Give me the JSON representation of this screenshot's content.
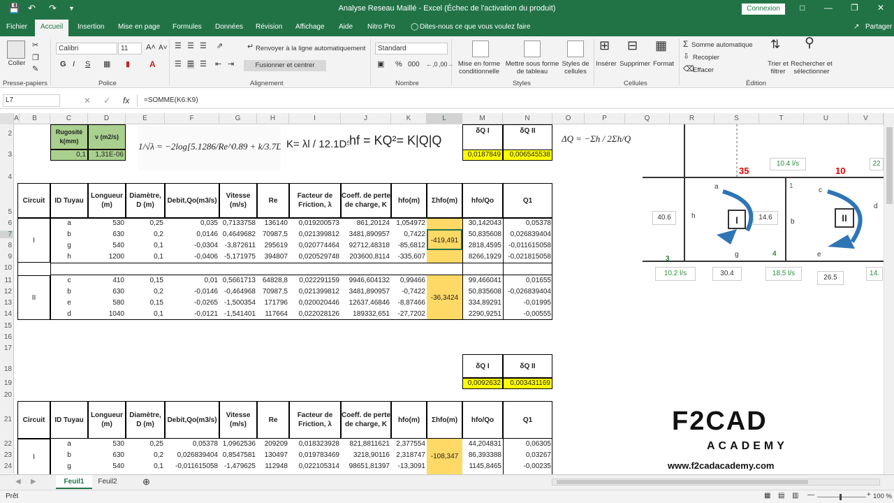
{
  "app": {
    "title": "Analyse Reseau Maillé - Excel (Échec de l'activation du produit)",
    "login": "Connexion",
    "share": "Partager",
    "tell_me": "Dites-nous ce que vous voulez faire"
  },
  "tabs": [
    "Fichier",
    "Accueil",
    "Insertion",
    "Mise en page",
    "Formules",
    "Données",
    "Révision",
    "Affichage",
    "Aide",
    "Nitro Pro"
  ],
  "ribbon": {
    "paste": "Coller",
    "font_name": "Calibri",
    "font_size": "11",
    "wrap": "Renvoyer à la ligne automatiquement",
    "merge": "Fusionner et centrer",
    "number_format": "Standard",
    "cond_format": "Mise en forme conditionnelle",
    "table_format": "Mettre sous forme de tableau",
    "cell_styles": "Styles de cellules",
    "insert": "Insérer",
    "delete": "Supprimer",
    "format": "Format",
    "autosum": "Somme automatique",
    "fill": "Recopier",
    "clear": "Effacer",
    "sort": "Trier et filtrer",
    "find": "Rechercher et sélectionner",
    "groups": [
      "Presse-papiers",
      "Police",
      "Alignement",
      "Nombre",
      "Styles",
      "Cellules",
      "Édition"
    ]
  },
  "formula_bar": {
    "name_box": "L7",
    "formula": "=SOMME(K6:K9)"
  },
  "columns": [
    "A",
    "B",
    "C",
    "D",
    "E",
    "F",
    "G",
    "H",
    "I",
    "J",
    "K",
    "L",
    "M",
    "N",
    "O",
    "P",
    "Q",
    "R",
    "S",
    "T",
    "U",
    "V"
  ],
  "rows": [
    "2",
    "3",
    "4",
    "5",
    "6",
    "7",
    "8",
    "9",
    "10",
    "11",
    "12",
    "13",
    "14",
    "15",
    "16",
    "17",
    "18",
    "19",
    "20",
    "21",
    "22",
    "23",
    "24"
  ],
  "top": {
    "rugosite": "Rugosité k(mm)",
    "nu": "ν (m2/s)",
    "k": "0,1",
    "nu_val": "1,31E-06",
    "dq1": "δQ I",
    "dq2": "δQ II",
    "dq1_val": "0,0187849",
    "dq2_val": "0,006545538",
    "eq_colebrook": "1/√λ = −2log[5.1286/Re^0.89 + k/3.7D]",
    "eq_k": "K= λl / 12.1D⁵",
    "eq_hf": "hf = KQ²= K|Q|Q",
    "eq_dq": "ΔQ = −Σh / 2Σh/Q"
  },
  "headers": [
    "Circuit",
    "ID Tuyau",
    "Longueur (m)",
    "Diamètre, D (m)",
    "Debit,Qo(m3/s)",
    "Vitesse (m/s)",
    "Re",
    "Facteur de Friction, λ",
    "Coeff. de perte de charge, K",
    "hfo(m)",
    "Σhfo(m)",
    "hfo/Qo",
    "Q1"
  ],
  "table1": {
    "circuit1": "I",
    "circuit2": "II",
    "sum1": "-419,491",
    "sum2": "-36,3424",
    "rows1": [
      [
        "a",
        "530",
        "0,25",
        "0,035",
        "0,7133758",
        "136140",
        "0,019200573",
        "861,20124",
        "1,054972",
        "30,142043",
        "0,05378"
      ],
      [
        "b",
        "630",
        "0,2",
        "0,0146",
        "0,4649682",
        "70987,5",
        "0,021399812",
        "3481,890957",
        "0,7422",
        "50,835608",
        "0,026839404"
      ],
      [
        "g",
        "540",
        "0,1",
        "-0,0304",
        "-3,872611",
        "295619",
        "0,020774464",
        "92712,48318",
        "-85,6812",
        "2818,4595",
        "-0,011615058"
      ],
      [
        "h",
        "1200",
        "0,1",
        "-0,0406",
        "-5,171975",
        "394807",
        "0,020529748",
        "203600,8114",
        "-335,607",
        "8266,1929",
        "-0,021815058"
      ]
    ],
    "rows2": [
      [
        "c",
        "410",
        "0,15",
        "0,01",
        "0,5661713",
        "64828,8",
        "0,022291159",
        "9946,604132",
        "0,99466",
        "99,466041",
        "0,01655"
      ],
      [
        "b",
        "630",
        "0,2",
        "-0,0146",
        "-0,464968",
        "70987,5",
        "0,021399812",
        "3481,890957",
        "-0,7422",
        "50,835608",
        "-0,026839404"
      ],
      [
        "e",
        "580",
        "0,15",
        "-0,0265",
        "-1,500354",
        "171796",
        "0,020020446",
        "12637,46846",
        "-8,87466",
        "334,89291",
        "-0,01995"
      ],
      [
        "d",
        "1040",
        "0,1",
        "-0,0121",
        "-1,541401",
        "117664",
        "0,022028126",
        "189332,651",
        "-27,7202",
        "2290,9251",
        "-0,00555"
      ]
    ]
  },
  "mid": {
    "dq1": "δQ I",
    "dq2": "δQ II",
    "dq1_val": "0,0092632",
    "dq2_val": "0,003431169"
  },
  "table2": {
    "circuit1": "I",
    "sum1": "-108,347",
    "rows1": [
      [
        "a",
        "530",
        "0,25",
        "0,05378",
        "1,0962536",
        "209209",
        "0,018323928",
        "821,8811621",
        "2,377554",
        "44,204831",
        "0,06305"
      ],
      [
        "b",
        "630",
        "0,2",
        "0,026839404",
        "0,8547581",
        "130497",
        "0,019783469",
        "3218,90116",
        "2,318747",
        "86,393388",
        "0,03267"
      ],
      [
        "g",
        "540",
        "0,1",
        "-0,011615058",
        "-1,479625",
        "112948",
        "0,022105314",
        "98651,81397",
        "-13,3091",
        "1145,8465",
        "-0,00235"
      ]
    ]
  },
  "diagram": {
    "flow_35": "35",
    "flow_10": "10",
    "f104": "10.4 l/s",
    "f102": "10.2 l/s",
    "f185": "18.5 l/s",
    "f22": "22",
    "f14": "14.",
    "v406": "40.6",
    "v146": "14.6",
    "v304": "30.4",
    "v265": "26.5",
    "n1": "1",
    "n3": "3",
    "n4": "4",
    "la": "a",
    "lb": "b",
    "lc": "c",
    "ld": "d",
    "le": "e",
    "lg": "g",
    "lh": "h",
    "loop1": "I",
    "loop2": "II"
  },
  "logo": {
    "brand": "F2CAD",
    "sub": "ACADEMY",
    "url": "www.f2cadacademy.com"
  },
  "sheets": [
    "Feuil1",
    "Feuil2"
  ],
  "status": {
    "ready": "Prêt",
    "zoom": "100 %"
  }
}
